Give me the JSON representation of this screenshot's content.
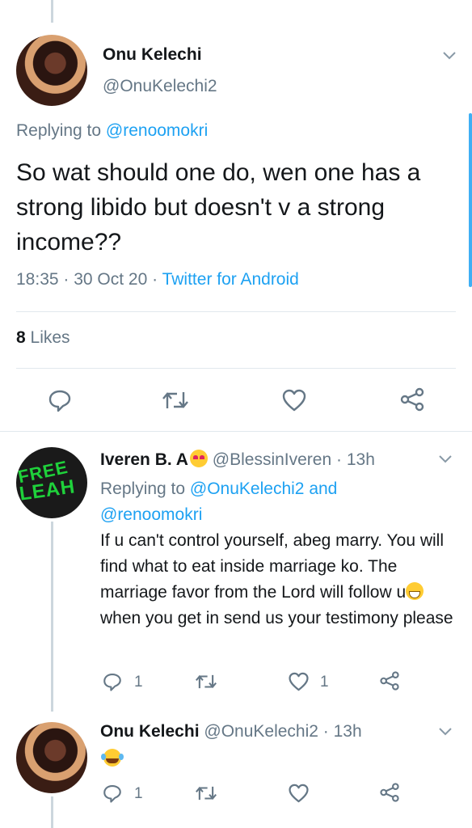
{
  "main_tweet": {
    "name": "Onu Kelechi",
    "handle": "@OnuKelechi2",
    "replying_prefix": "Replying to ",
    "replying_to": "@renoomokri",
    "text": "So wat should one do, wen  one has a strong libido but doesn't v a strong income??",
    "time": "18:35",
    "date": "30 Oct 20",
    "separator": " · ",
    "source": "Twitter for Android",
    "likes_count": "8",
    "likes_label": " Likes"
  },
  "reply1": {
    "name": "Iveren B. A",
    "handle": "@BlessinIveren",
    "age": "13h",
    "replying_prefix": "Replying to ",
    "replying_to_1": "@OnuKelechi2",
    "replying_and": " and",
    "replying_to_2": "@renoomokri",
    "text_part1": "If u can't control yourself, abeg marry. You will find what to eat inside marriage ko. The marriage favor from the Lord will follow u",
    "text_part2": " when you get in send us your testimony please",
    "avatar_text_1": "FREE",
    "avatar_text_2": "LEAH",
    "reply_count": "1",
    "like_count": "1"
  },
  "reply2": {
    "name": "Onu Kelechi",
    "handle": "@OnuKelechi2",
    "age": "13h",
    "reply_count": "1"
  },
  "colors": {
    "accent": "#1da1f2",
    "secondary_text": "#657786",
    "avatar_green": "#1fd13b"
  }
}
